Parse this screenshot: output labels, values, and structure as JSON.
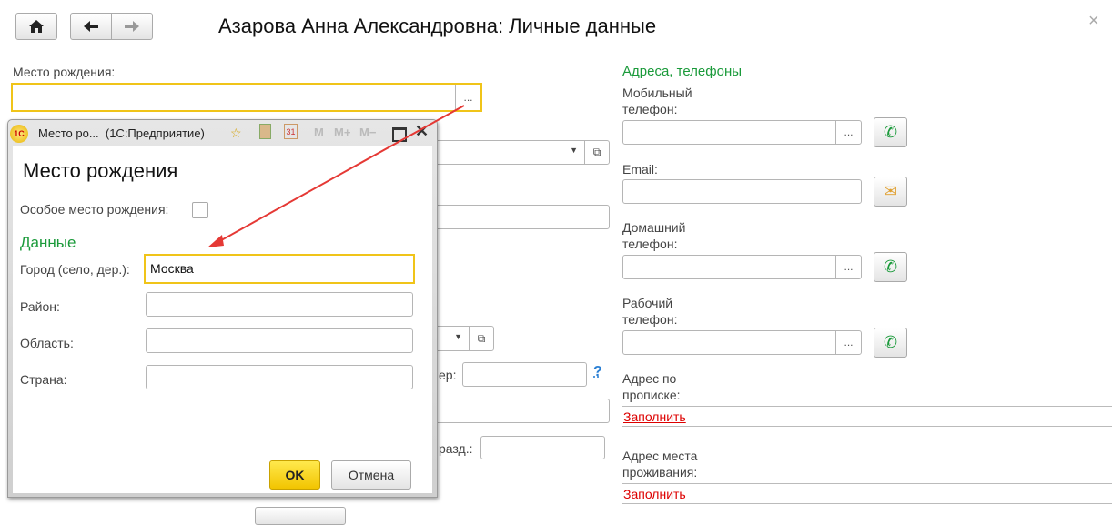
{
  "header": {
    "title": "Азарова Анна Александровна: Личные данные",
    "close": "×"
  },
  "main": {
    "birthplace_label": "Место рождения:",
    "birthplace_value": "",
    "dots": "...",
    "number_label_partial": "ер:",
    "help": "?",
    "division_label_partial": "разд.:"
  },
  "contacts": {
    "section_title": "Адреса, телефоны",
    "mobile_label": [
      "Мобильный",
      "телефон:"
    ],
    "email_label": "Email:",
    "home_label": [
      "Домашний",
      "телефон:"
    ],
    "work_label": [
      "Рабочий",
      "телефон:"
    ],
    "reg_address_label": [
      "Адрес по",
      "прописке:"
    ],
    "live_address_label": [
      "Адрес места",
      "проживания:"
    ],
    "fill_link": "Заполнить"
  },
  "dialog": {
    "window_title": "Место ро...  (1С:Предприятие)",
    "toolbar": [
      "M",
      "M+",
      "M−"
    ],
    "calendar_day": "31",
    "heading": "Место рождения",
    "special_label": "Особое место рождения:",
    "special_checked": false,
    "group_title": "Данные",
    "fields": [
      {
        "label": "Город (село, дер.):",
        "value": "Москва"
      },
      {
        "label": "Район:",
        "value": ""
      },
      {
        "label": "Область:",
        "value": ""
      },
      {
        "label": "Страна:",
        "value": ""
      }
    ],
    "ok": "OK",
    "cancel": "Отмена"
  },
  "colors": {
    "accent_green": "#1a9a3a",
    "highlight": "#f0c419",
    "link_red": "#d00000",
    "arrow": "#e53935"
  }
}
